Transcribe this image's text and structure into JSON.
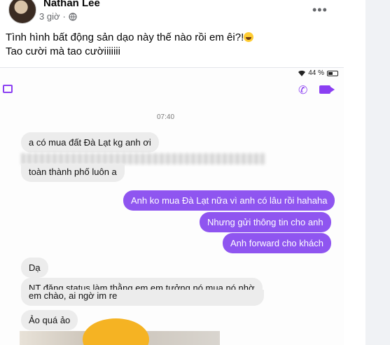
{
  "post": {
    "author": "Nathan Lee",
    "time": "3 giờ",
    "more_label": "•••",
    "caption_line1": "Tình hình bất động sản dạo này thế nào rồi em êi?!",
    "caption_line2": "Tao cười mà tao cườiiiiiii"
  },
  "screenshot": {
    "battery": "44 %",
    "timestamp": "07:40",
    "messages": [
      {
        "side": "in",
        "text": "a có mua đất Đà Lạt kg anh ơi"
      },
      {
        "side": "in",
        "text": "toàn thành phố luôn a"
      },
      {
        "side": "out",
        "text": "Anh ko mua Đà Lạt nữa vì anh có lâu rồi hahaha"
      },
      {
        "side": "out",
        "text": "Nhưng gửi thông tin cho anh"
      },
      {
        "side": "out",
        "text": "Anh forward cho khách"
      },
      {
        "side": "in",
        "text": "Dạ"
      },
      {
        "side": "in",
        "text": "NT đăng status làm thằng em em tưởng nó mua nó nhờ"
      },
      {
        "side": "in",
        "text": "em chào, ai ngờ im re"
      },
      {
        "side": "in",
        "text": "Ảo quá ảo"
      }
    ]
  },
  "colors": {
    "accent": "#8f55f0",
    "incoming": "#ececec"
  }
}
